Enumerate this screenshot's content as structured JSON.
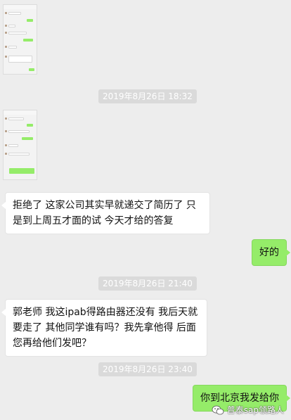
{
  "thumbnail_1": {
    "title": ""
  },
  "thumbnail_2": {
    "title": ""
  },
  "timestamps": [
    "2019年8月26日 18:32",
    "2019年8月26日 21:40",
    "2019年8月26日 23:40"
  ],
  "messages": [
    {
      "side": "left",
      "text": "拒绝了 这家公司其实早就递交了简历了 只是到上周五才面的试 今天才给的答复"
    },
    {
      "side": "right",
      "text": "好的"
    },
    {
      "side": "left",
      "text": "郭老师  我这ipab得路由器还没有  我后天就要走了  其他同学谁有吗？我先拿他得 后面您再给他们发吧？"
    },
    {
      "side": "right",
      "text": "你到北京我发给你"
    }
  ],
  "watermark": {
    "icon": "wechat-icon",
    "text": "普泰sap领路人"
  },
  "colors": {
    "background": "#ededed",
    "self_bubble": "#95ec69",
    "other_bubble": "#ffffff",
    "timestamp_pill": "#dadada"
  }
}
